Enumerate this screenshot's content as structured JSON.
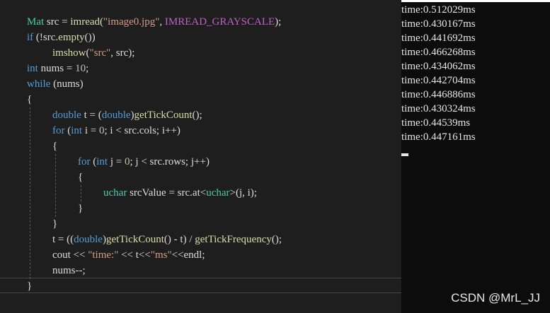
{
  "editor": {
    "lines": [
      {
        "indent": 0,
        "tokens": [
          [
            "ty",
            "Mat"
          ],
          [
            "var",
            " src = "
          ],
          [
            "fn",
            "imread"
          ],
          [
            "var",
            "("
          ],
          [
            "str",
            "\"image0.jpg\""
          ],
          [
            "var",
            ", "
          ],
          [
            "macro",
            "IMREAD_GRAYSCALE"
          ],
          [
            "var",
            ");"
          ]
        ]
      },
      {
        "indent": 0,
        "tokens": [
          [
            "kw",
            "if"
          ],
          [
            "var",
            " (!src."
          ],
          [
            "fn",
            "empty"
          ],
          [
            "var",
            "())"
          ]
        ]
      },
      {
        "indent": 1,
        "tokens": [
          [
            "fn",
            "imshow"
          ],
          [
            "var",
            "("
          ],
          [
            "str",
            "\"src\""
          ],
          [
            "var",
            ", src);"
          ]
        ]
      },
      {
        "indent": 0,
        "tokens": [
          [
            "kw",
            "int"
          ],
          [
            "var",
            " nums = "
          ],
          [
            "num",
            "10"
          ],
          [
            "var",
            ";"
          ]
        ]
      },
      {
        "indent": 0,
        "tokens": [
          [
            "kw",
            "while"
          ],
          [
            "var",
            " (nums)"
          ]
        ]
      },
      {
        "indent": 0,
        "tokens": [
          [
            "var",
            "{"
          ]
        ]
      },
      {
        "indent": 1,
        "tokens": [
          [
            "kw",
            "double"
          ],
          [
            "var",
            " t = ("
          ],
          [
            "kw",
            "double"
          ],
          [
            "var",
            ")"
          ],
          [
            "fn",
            "getTickCount"
          ],
          [
            "var",
            "();"
          ]
        ]
      },
      {
        "indent": 1,
        "tokens": [
          [
            "kw",
            "for"
          ],
          [
            "var",
            " ("
          ],
          [
            "kw",
            "int"
          ],
          [
            "var",
            " i = "
          ],
          [
            "num",
            "0"
          ],
          [
            "var",
            "; i < src.cols; i++)"
          ]
        ]
      },
      {
        "indent": 1,
        "tokens": [
          [
            "var",
            "{"
          ]
        ]
      },
      {
        "indent": 2,
        "tokens": [
          [
            "kw",
            "for"
          ],
          [
            "var",
            " ("
          ],
          [
            "kw",
            "int"
          ],
          [
            "var",
            " j = "
          ],
          [
            "num",
            "0"
          ],
          [
            "var",
            "; j < src.rows; j++)"
          ]
        ]
      },
      {
        "indent": 2,
        "tokens": [
          [
            "var",
            "{"
          ]
        ]
      },
      {
        "indent": 3,
        "tokens": [
          [
            "ty",
            "uchar"
          ],
          [
            "var",
            " srcValue = src.at<"
          ],
          [
            "ty",
            "uchar"
          ],
          [
            "var",
            ">(j, i);"
          ]
        ]
      },
      {
        "indent": 2,
        "tokens": [
          [
            "var",
            "}"
          ]
        ]
      },
      {
        "indent": 1,
        "tokens": [
          [
            "var",
            "}"
          ]
        ]
      },
      {
        "indent": 1,
        "tokens": [
          [
            "var",
            "t = (("
          ],
          [
            "kw",
            "double"
          ],
          [
            "var",
            ")"
          ],
          [
            "fn",
            "getTickCount"
          ],
          [
            "var",
            "() - t) / "
          ],
          [
            "fn",
            "getTickFrequency"
          ],
          [
            "var",
            "();"
          ]
        ]
      },
      {
        "indent": 1,
        "tokens": [
          [
            "var",
            "cout << "
          ],
          [
            "str",
            "\"time:\""
          ],
          [
            "var",
            " << t<<"
          ],
          [
            "str",
            "\"ms\""
          ],
          [
            "var",
            "<<endl;"
          ]
        ]
      },
      {
        "indent": 1,
        "tokens": [
          [
            "var",
            "nums--;"
          ]
        ]
      },
      {
        "indent": 0,
        "tokens": [
          [
            "var",
            "}"
          ]
        ]
      }
    ]
  },
  "console": {
    "lines": [
      "time:0.512029ms",
      "time:0.430167ms",
      "time:0.441692ms",
      "time:0.466268ms",
      "time:0.434062ms",
      "time:0.442704ms",
      "time:0.446886ms",
      "time:0.430324ms",
      "time:0.44539ms",
      "time:0.447161ms"
    ]
  },
  "watermark": "CSDN @MrL_JJ",
  "colors": {
    "editor_bg": "#1e1e1e",
    "console_bg": "#0c0c0c",
    "keyword": "#569cd6",
    "type": "#4ec9b0",
    "string": "#d69d85",
    "number": "#b5cea8",
    "macro": "#bd63c5",
    "function": "#dcdcaa"
  }
}
